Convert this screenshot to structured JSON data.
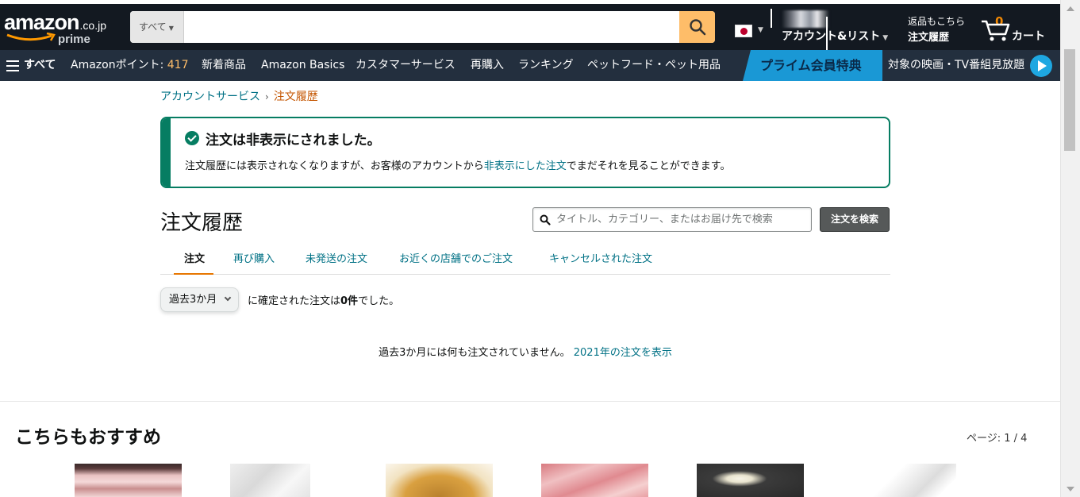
{
  "header": {
    "logo_word": "amazon",
    "logo_tld": ".co.jp",
    "logo_prime": "prime",
    "search_category": "すべて",
    "search_placeholder": "",
    "account_line2": "アカウント&リスト",
    "orders_line1": "返品もこちら",
    "orders_line2": "注文履歴",
    "cart_count": "0",
    "cart_label": "カート"
  },
  "subnav": {
    "all": "すべて",
    "points_label": "Amazonポイント: ",
    "points_value": "417",
    "items": [
      "新着商品",
      "Amazon Basics",
      "カスタマーサービス",
      "再購入",
      "ランキング",
      "ペットフード・ペット用品"
    ],
    "prime_promo": "プライム会員特典",
    "video_promo": "対象の映画・TV番組見放題"
  },
  "breadcrumb": {
    "parent": "アカウントサービス",
    "separator": "›",
    "current": "注文履歴"
  },
  "alert": {
    "title": "注文は非表示にされました。",
    "body_before": "注文履歴には表示されなくなりますが、お客様のアカウントから",
    "body_link": "非表示にした注文",
    "body_after": "でまだそれを見ることができます。"
  },
  "orders": {
    "title": "注文履歴",
    "search_placeholder": "タイトル、カテゴリー、またはお届け先で検索",
    "search_button": "注文を検索",
    "tabs": [
      "注文",
      "再び購入",
      "未発送の注文",
      "お近くの店舗でのご注文",
      "キャンセルされた注文"
    ],
    "period": "過去3か月",
    "summary_before": "に確定された注文は",
    "summary_count": "0件",
    "summary_after": "でした。",
    "empty_text": "過去3か月には何も注文されていません。",
    "empty_link": "2021年の注文を表示"
  },
  "recommendations": {
    "title": "こちらもおすすめ",
    "page": "ページ: 1 / 4"
  },
  "colors": {
    "nav_bg": "#131921",
    "subnav_bg": "#232f3e",
    "search_button": "#febd69",
    "link": "#007185",
    "success": "#067d62",
    "accent_orange": "#e77600",
    "prime_blue": "#1a98d5"
  }
}
